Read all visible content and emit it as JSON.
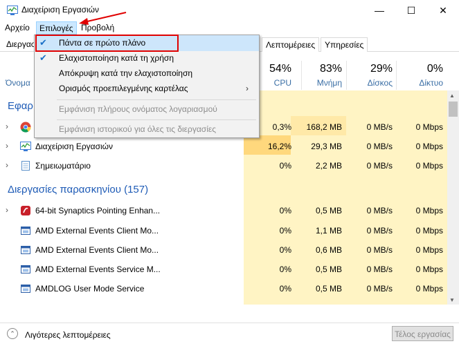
{
  "window": {
    "title": "Διαχείριση Εργασιών",
    "controls": {
      "minimize": "—",
      "maximize": "☐",
      "close": "✕"
    }
  },
  "menubar": {
    "file": "Αρχείο",
    "options": "Επιλογές",
    "view": "Προβολή"
  },
  "tabs": [
    "Διεργασ",
    "Λεπτομέρειες",
    "Υπηρεσίες"
  ],
  "columns": {
    "name": "Όνομα",
    "cpu": {
      "pct": "54%",
      "label": "CPU"
    },
    "memory": {
      "pct": "83%",
      "label": "Μνήμη"
    },
    "disk": {
      "pct": "29%",
      "label": "Δίσκος"
    },
    "network": {
      "pct": "0%",
      "label": "Δίκτυο"
    }
  },
  "groups": {
    "apps": "Εφαρ",
    "background": "Διεργασίες παρασκηνίου (157)"
  },
  "apps": [
    {
      "name": "",
      "cpu": "0,3%",
      "memory": "168,2 MB",
      "disk": "0 MB/s",
      "network": "0 Mbps",
      "icon": "chrome-icon"
    },
    {
      "name": "Διαχείριση Εργασιών",
      "cpu": "16,2%",
      "memory": "29,3 MB",
      "disk": "0 MB/s",
      "network": "0 Mbps",
      "icon": "task-manager-icon"
    },
    {
      "name": "Σημειωματάριο",
      "cpu": "0%",
      "memory": "2,2 MB",
      "disk": "0 MB/s",
      "network": "0 Mbps",
      "icon": "notepad-icon"
    }
  ],
  "background": [
    {
      "name": "64-bit Synaptics Pointing Enhan...",
      "cpu": "0%",
      "memory": "0,5 MB",
      "disk": "0 MB/s",
      "network": "0 Mbps",
      "icon": "synaptics-icon"
    },
    {
      "name": "AMD External Events Client Mo...",
      "cpu": "0%",
      "memory": "1,1 MB",
      "disk": "0 MB/s",
      "network": "0 Mbps",
      "icon": "service-icon"
    },
    {
      "name": "AMD External Events Client Mo...",
      "cpu": "0%",
      "memory": "0,6 MB",
      "disk": "0 MB/s",
      "network": "0 Mbps",
      "icon": "service-icon"
    },
    {
      "name": "AMD External Events Service M...",
      "cpu": "0%",
      "memory": "0,5 MB",
      "disk": "0 MB/s",
      "network": "0 Mbps",
      "icon": "service-icon"
    },
    {
      "name": "AMDLOG User Mode Service",
      "cpu": "0%",
      "memory": "0,5 MB",
      "disk": "0 MB/s",
      "network": "0 Mbps",
      "icon": "service-icon"
    }
  ],
  "dropdown": {
    "always_on_top": "Πάντα σε πρώτο πλάνο",
    "minimize_on_use": "Ελαχιστοποίηση κατά τη χρήση",
    "hide_when_minimized": "Απόκρυψη κατά την ελαχιστοποίηση",
    "default_tab": "Ορισμός προεπιλεγμένης καρτέλας",
    "show_full_account": "Εμφάνιση πλήρους ονόματος λογαριασμού",
    "show_history": "Εμφάνιση ιστορικού για όλες τις διεργασίες",
    "checked": [
      "always_on_top",
      "minimize_on_use"
    ]
  },
  "footer": {
    "fewer_details": "Λιγότερες λεπτομέρειες",
    "end_task": "Τέλος εργασίας"
  },
  "colors": {
    "highlight_low": "#fff4c4",
    "highlight_mid": "#ffe9a8",
    "highlight_cpu": "#ffd87d",
    "accent": "#1e5bb6",
    "annotation": "#e00000"
  }
}
